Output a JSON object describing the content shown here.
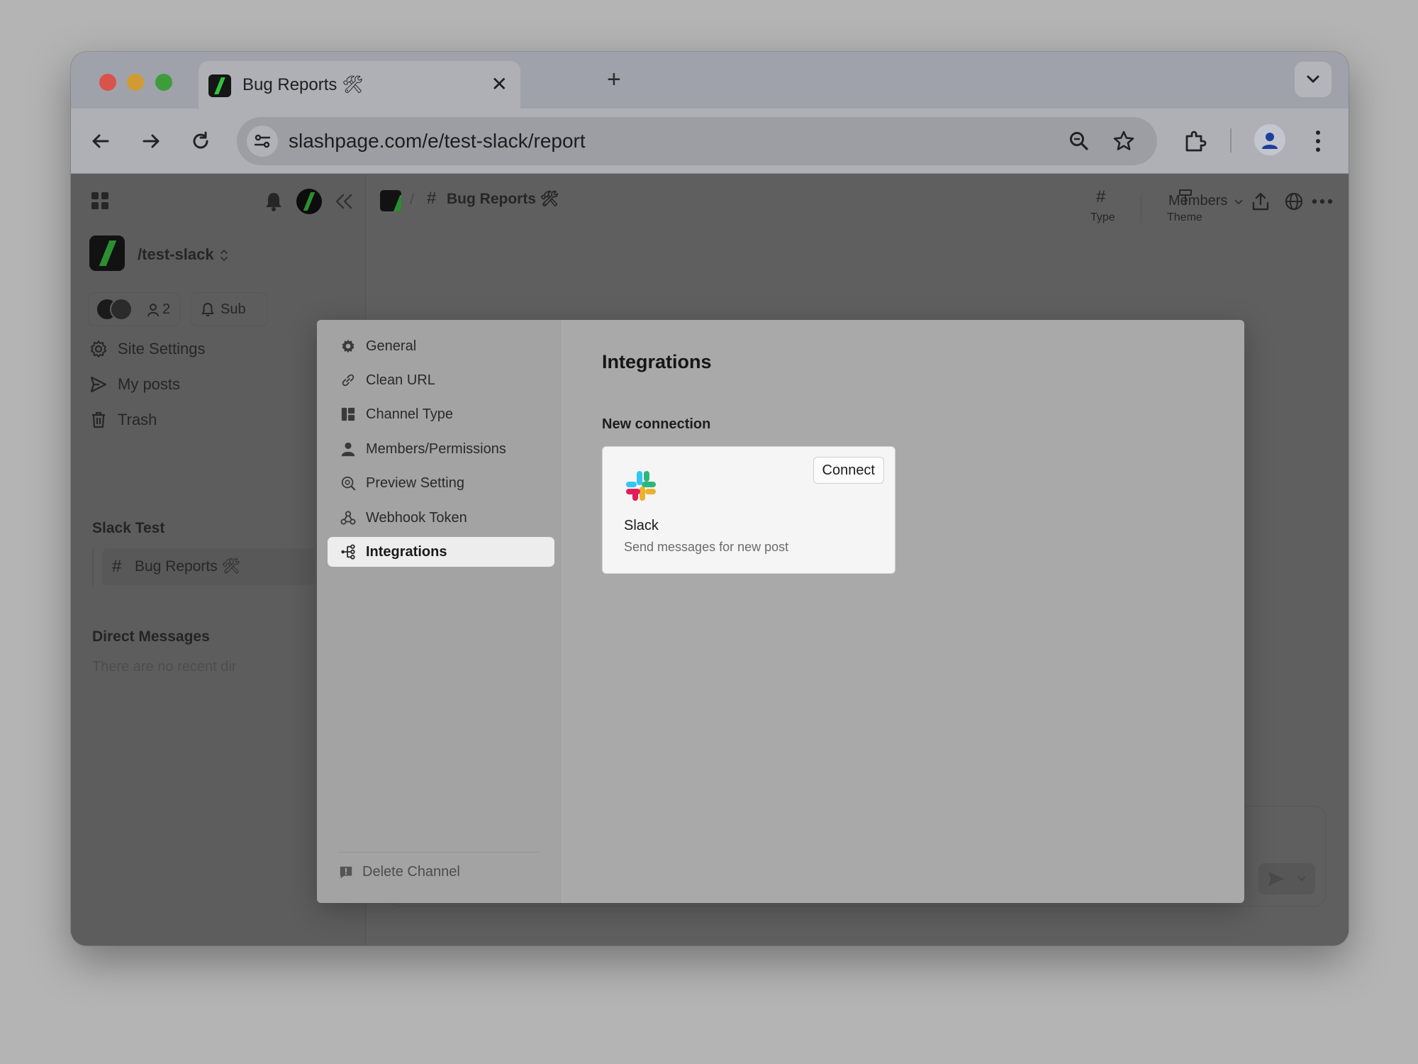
{
  "browser": {
    "tab_title": "Bug Reports 🛠",
    "url": "slashpage.com/e/test-slack/report"
  },
  "sidebar": {
    "workspace": "/test-slack",
    "member_count": "2",
    "subscribe_label": "Sub",
    "nav": [
      {
        "label": "Site Settings"
      },
      {
        "label": "My posts"
      },
      {
        "label": "Trash"
      }
    ],
    "section_slack_test": "Slack Test",
    "channel": "Bug Reports 🛠",
    "section_dm": "Direct Messages",
    "dm_empty": "There are no recent dir"
  },
  "header": {
    "breadcrumb_channel": "Bug Reports 🛠",
    "type_label": "Type",
    "theme_label": "Theme",
    "members_label": "Members"
  },
  "modal": {
    "menu": [
      {
        "label": "General",
        "icon": "gear-icon"
      },
      {
        "label": "Clean URL",
        "icon": "link-icon"
      },
      {
        "label": "Channel Type",
        "icon": "layout-icon"
      },
      {
        "label": "Members/Permissions",
        "icon": "person-icon"
      },
      {
        "label": "Preview Setting",
        "icon": "preview-icon"
      },
      {
        "label": "Webhook Token",
        "icon": "webhook-icon"
      },
      {
        "label": "Integrations",
        "icon": "integrations-icon",
        "active": true
      }
    ],
    "delete_label": "Delete Channel",
    "title": "Integrations",
    "subtitle": "New connection",
    "card": {
      "name": "Slack",
      "description": "Send messages for new post",
      "connect_label": "Connect"
    }
  },
  "colors": {
    "slack_blue": "#36C5F0",
    "slack_green": "#2EB67D",
    "slack_yellow": "#ECB22E",
    "slack_red": "#E01E5A",
    "brand_green": "#31C33E"
  }
}
